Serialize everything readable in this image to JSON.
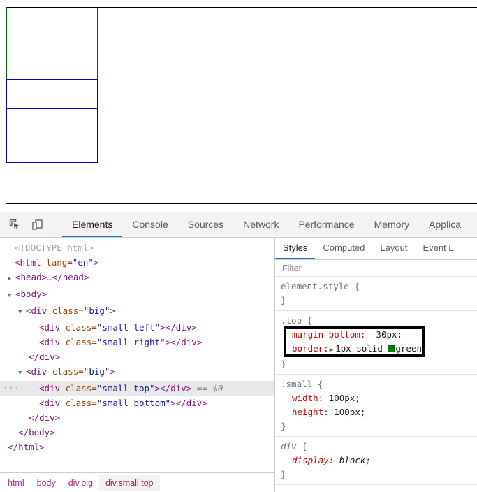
{
  "rendered_page": {
    "boxes": [
      {
        "name": "small-top-green",
        "border_color": "#006400",
        "note": "green bordered 100x100 box, margin-bottom -30px"
      },
      {
        "name": "small-bottom-green",
        "border_color": "#006400"
      },
      {
        "name": "small-left-blue",
        "border_color": "#0000cd"
      },
      {
        "name": "small-right-blue",
        "border_color": "#0000cd"
      },
      {
        "name": "body-outline",
        "border_color": "#000000"
      }
    ]
  },
  "devtools": {
    "toolbar": {
      "inspect_icon": "inspect-element-icon",
      "device_icon": "device-toolbar-icon",
      "tabs": [
        {
          "label": "Elements",
          "active": true
        },
        {
          "label": "Console",
          "active": false
        },
        {
          "label": "Sources",
          "active": false
        },
        {
          "label": "Network",
          "active": false
        },
        {
          "label": "Performance",
          "active": false
        },
        {
          "label": "Memory",
          "active": false
        },
        {
          "label": "Applica",
          "active": false
        }
      ]
    },
    "elements": {
      "lines": {
        "l1_doctype": "<!DOCTYPE html>",
        "l2_html_open": "<html lang=\"en\">",
        "l3_head": "<head>…</head>",
        "l4_body_open": "<body>",
        "l5_big_open": "<div class=\"big\">",
        "l6_small_left": "<div class=\"small left\"></div>",
        "l7_small_right": "<div class=\"small right\"></div>",
        "l8_div_close": "</div>",
        "l9_big_open2": "<div class=\"big\">",
        "l10_small_top": "<div class=\"small top\"></div>",
        "l10_selected_marker": "== $0",
        "l10_gutter": "···",
        "l11_small_bottom": "<div class=\"small bottom\"></div>",
        "l12_div_close": "</div>",
        "l13_body_close": "</body>",
        "l14_html_close": "</html>"
      },
      "tokens": {
        "lt": "<",
        "gt": ">",
        "lt_slash": "</",
        "tag_html": "html",
        "tag_head": "head",
        "tag_body": "body",
        "tag_div": "div",
        "attr_lang": " lang=",
        "attr_class": " class=",
        "val_en": "\"en\"",
        "val_big": "\"big\"",
        "val_small_left": "\"small left\"",
        "val_small_right": "\"small right\"",
        "val_small_top": "\"small top\"",
        "val_small_bottom": "\"small bottom\"",
        "ellipsis": "…",
        "twisty_open": "▼",
        "twisty_closed": "▶"
      },
      "breadcrumb": [
        {
          "label": "html",
          "active": false
        },
        {
          "label": "body",
          "active": false
        },
        {
          "label": "div.big",
          "active": false
        },
        {
          "label": "div.small.top",
          "active": true
        }
      ]
    },
    "styles": {
      "tabs": [
        {
          "label": "Styles",
          "active": true
        },
        {
          "label": "Computed",
          "active": false
        },
        {
          "label": "Layout",
          "active": false
        },
        {
          "label": "Event L",
          "active": false
        }
      ],
      "filter_placeholder": "Filter",
      "filter_value": "",
      "rules": [
        {
          "selector": "element.style",
          "open_brace": "{",
          "close_brace": "}",
          "ua": false,
          "highlighted": false,
          "properties": []
        },
        {
          "selector": ".top",
          "open_brace": "{",
          "close_brace": "}",
          "ua": false,
          "highlighted": true,
          "properties": [
            {
              "name": "margin-bottom:",
              "value": "-30px;",
              "expandable": false,
              "swatch": null
            },
            {
              "name": "border:",
              "value": "1px solid",
              "value_tail": "green;",
              "expandable": true,
              "swatch": "#008000"
            }
          ]
        },
        {
          "selector": ".small",
          "open_brace": "{",
          "close_brace": "}",
          "ua": false,
          "highlighted": false,
          "properties": [
            {
              "name": "width:",
              "value": "100px;",
              "expandable": false,
              "swatch": null
            },
            {
              "name": "height:",
              "value": "100px;",
              "expandable": false,
              "swatch": null
            }
          ]
        },
        {
          "selector": "div",
          "open_brace": "{",
          "close_brace": "}",
          "ua": true,
          "highlighted": false,
          "properties": [
            {
              "name": "display:",
              "value": "block;",
              "expandable": false,
              "swatch": null
            }
          ]
        }
      ]
    }
  },
  "colors": {
    "green": "#008000",
    "blue": "#0000cd",
    "accent": "#1a73e8",
    "highlight_outline": "#000000"
  }
}
